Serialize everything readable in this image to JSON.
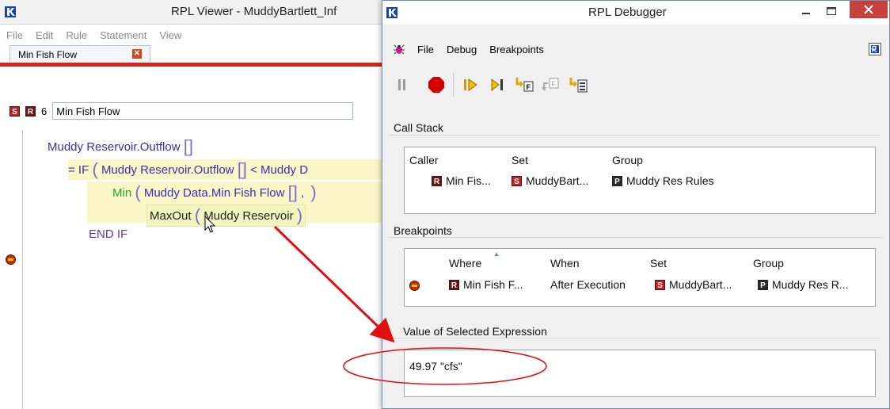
{
  "viewer": {
    "title": "RPL Viewer - MuddyBartlett_Inf",
    "menu": [
      "File",
      "Edit",
      "Rule",
      "Statement",
      "View"
    ],
    "tab_label": "Min Fish Flow",
    "rule": {
      "s_badge": "S",
      "r_badge": "R",
      "number": "6",
      "name": "Min Fish Flow"
    },
    "code": {
      "line1": "Muddy Reservoir.Outflow",
      "line2_prefix": "= IF",
      "line2_arg": "Muddy Reservoir.Outflow",
      "line2_op": "<",
      "line2_tail": "Muddy D",
      "line3_fn": "Min",
      "line3_arg": "Muddy Data.Min Fish Flow",
      "line3_comma": ",",
      "line4_fn": "MaxOut",
      "line4_arg": "Muddy Reservoir",
      "line5": "END IF",
      "open_paren": "(",
      "close_paren": ")",
      "brackets": "[]"
    }
  },
  "debugger": {
    "title": "RPL Debugger",
    "menu": [
      "File",
      "Debug",
      "Breakpoints"
    ],
    "call_stack": {
      "label": "Call Stack",
      "columns": [
        "Caller",
        "Set",
        "Group"
      ],
      "rows": [
        {
          "caller": "Min Fis...",
          "set": "MuddyBart...",
          "group": "Muddy Res Rules"
        }
      ]
    },
    "breakpoints": {
      "label": "Breakpoints",
      "columns": [
        "Where",
        "When",
        "Set",
        "Group"
      ],
      "rows": [
        {
          "where": "Min Fish F...",
          "when": "After Execution",
          "set": "MuddyBart...",
          "group": "Muddy Res R..."
        }
      ]
    },
    "value": {
      "label": "Value of Selected Expression",
      "text": "49.97 \"cfs\""
    }
  },
  "colors": {
    "red_accent": "#d9261c",
    "annotation_red": "#e01010",
    "code_purple": "#3b2fa6",
    "min_green": "#27a12a",
    "highlight_yellow": "#fbf6c8",
    "close_button": "#c7403a"
  }
}
